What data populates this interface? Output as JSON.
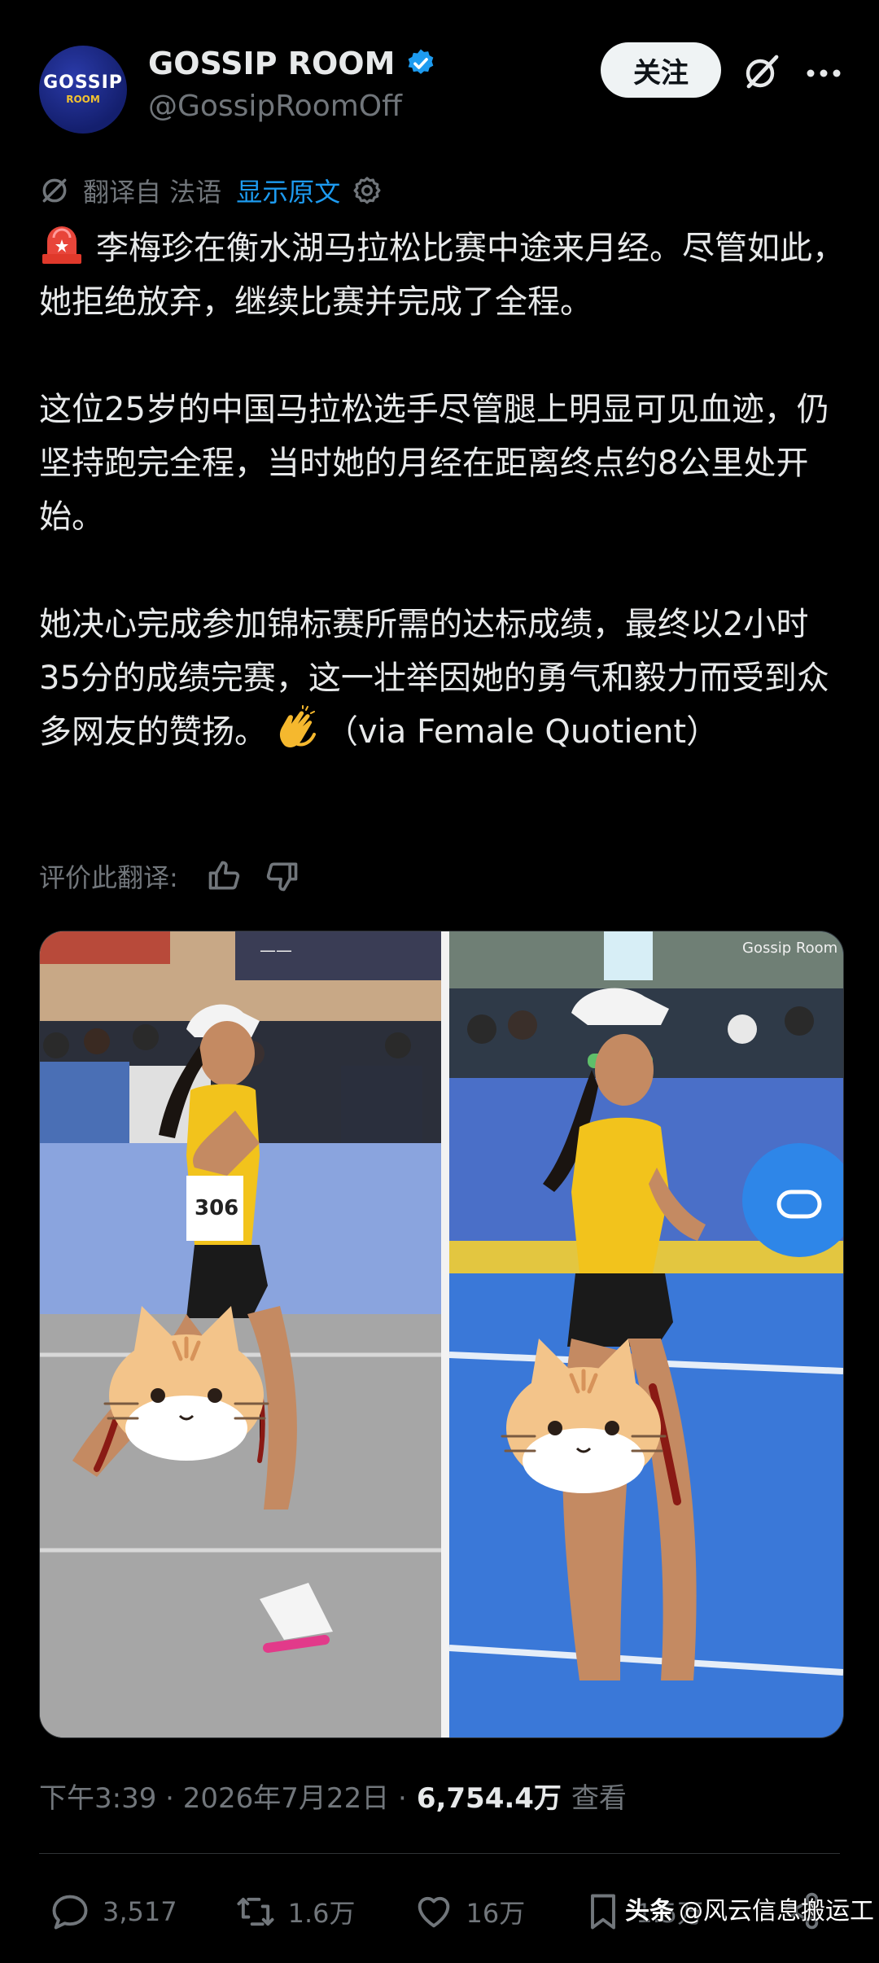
{
  "account": {
    "avatar_line1": "GOSSIP",
    "avatar_line2": "ROOM",
    "name": "GOSSIP ROOM",
    "handle": "@GossipRoomOff",
    "follow_label": "关注"
  },
  "translation": {
    "translated_from": "翻译自 法语",
    "show_original": "显示原文",
    "rate_label": "评价此翻译:"
  },
  "post": {
    "para1": "李梅珍在衡水湖马拉松比赛中途来月经。尽管如此，她拒绝放弃，继续比赛并完成了全程。",
    "para2": "这位25岁的中国马拉松选手尽管腿上明显可见血迹，仍坚持跑完全程，当时她的月经在距离终点约8公里处开始。",
    "para3a": "她决心完成参加锦标赛所需的达标成绩，最终以2小时35分的成绩完赛，这一壮举因她的勇气和毅力而受到众多网友的赞扬。",
    "para3b": "（via Female Quotient）"
  },
  "media": {
    "bib_number": "306",
    "watermark_photo": "Gossip Room"
  },
  "meta": {
    "timestamp": "下午3:39 · 2026年7月22日 ·",
    "views_count": "6,754.4万",
    "views_label": "查看"
  },
  "actions": {
    "replies": "3,517",
    "reposts": "1.6万",
    "likes": "16万",
    "bookmarks": "1.5万"
  },
  "source_watermark": {
    "brand": "头条",
    "author": "@风云信息搬运工"
  },
  "colors": {
    "background": "#000000",
    "text_primary": "#e7e9ea",
    "text_muted": "#71767b",
    "link": "#1d9bf0",
    "verified": "#1d9bf0",
    "divider": "#2f3336"
  },
  "icons": [
    "verified-badge-icon",
    "grok-icon",
    "more-icon",
    "translate-icon",
    "settings-icon",
    "siren-emoji-icon",
    "clap-emoji-icon",
    "thumbs-up-icon",
    "thumbs-down-icon",
    "reply-icon",
    "repost-icon",
    "like-icon",
    "bookmark-icon",
    "share-icon"
  ]
}
